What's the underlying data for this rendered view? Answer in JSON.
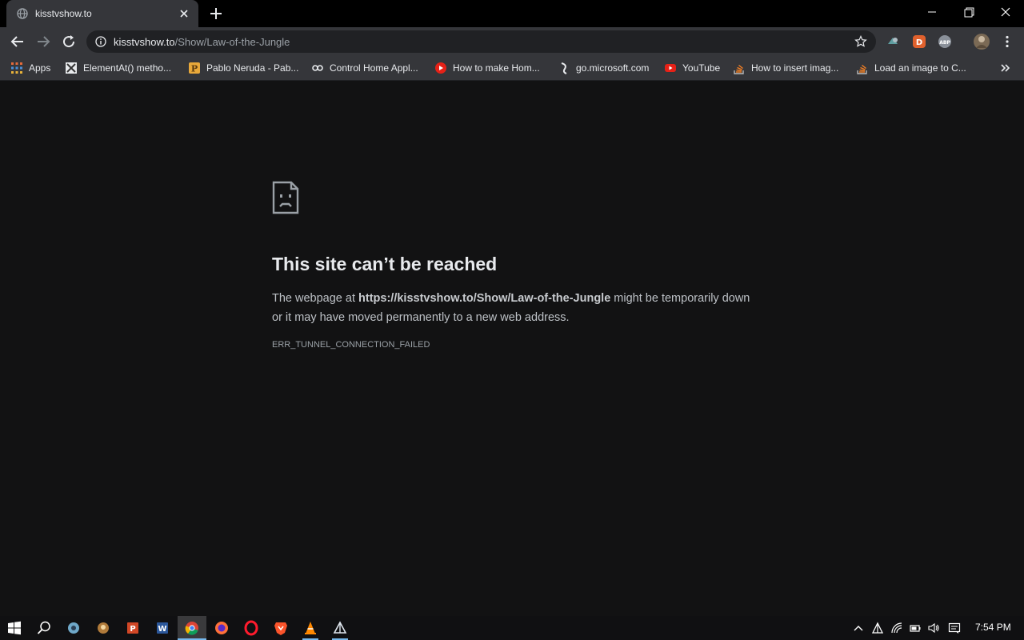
{
  "tab": {
    "title": "kisstvshow.to"
  },
  "omnibox": {
    "host": "kisstvshow.to",
    "path": "/Show/Law-of-the-Jungle"
  },
  "bookmarks": [
    {
      "label": "Apps",
      "icon": "apps-grid-icon"
    },
    {
      "label": "ElementAt() metho...",
      "icon": "devexpress-icon"
    },
    {
      "label": "Pablo Neruda - Pab...",
      "icon": "poetry-icon"
    },
    {
      "label": "Control Home Appl...",
      "icon": "link-icon"
    },
    {
      "label": "How to make Hom...",
      "icon": "youtube-icon"
    },
    {
      "label": "go.microsoft.com",
      "icon": "microsoft-icon"
    },
    {
      "label": "YouTube",
      "icon": "youtube-icon"
    },
    {
      "label": "How to insert imag...",
      "icon": "stackoverflow-icon"
    },
    {
      "label": "Load an image to C...",
      "icon": "stackoverflow-icon"
    }
  ],
  "error": {
    "title": "This site can’t be reached",
    "desc_prefix": "The webpage at ",
    "desc_url": "https://kisstvshow.to/Show/Law-of-the-Jungle",
    "desc_suffix": " might be temporarily down or it may have moved permanently to a new web address.",
    "code": "ERR_TUNNEL_CONNECTION_FAILED"
  },
  "taskbar": {
    "clock": "7:54 PM"
  },
  "colors": {
    "page_bg": "#121213",
    "toolbar": "#35363a",
    "omnibox": "#202124",
    "text": "#e8eaed",
    "accent": "#76b9ed"
  }
}
